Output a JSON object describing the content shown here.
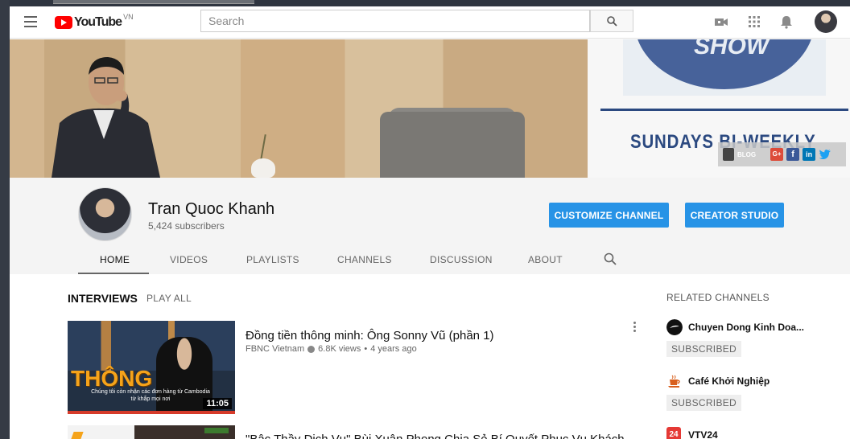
{
  "header": {
    "logo_text": "YouTube",
    "logo_country": "VN",
    "search_placeholder": "Search"
  },
  "banner": {
    "show_text": "SHOW",
    "tagline": "SUNDAYS BI-WEEKLY",
    "social_blog": "BLOG",
    "social_gplus": "G+",
    "social_fb": "f",
    "social_in": "in"
  },
  "channel": {
    "name": "Tran Quoc Khanh",
    "subscribers": "5,424 subscribers",
    "customize_label": "CUSTOMIZE CHANNEL",
    "studio_label": "CREATOR STUDIO"
  },
  "tabs": [
    {
      "label": "HOME"
    },
    {
      "label": "VIDEOS"
    },
    {
      "label": "PLAYLISTS"
    },
    {
      "label": "CHANNELS"
    },
    {
      "label": "DISCUSSION"
    },
    {
      "label": "ABOUT"
    }
  ],
  "shelf": {
    "title": "INTERVIEWS",
    "play_all": "PLAY ALL",
    "videos": [
      {
        "title": "Đồng tiền thông minh: Ông Sonny Vũ (phần 1)",
        "channel": "FBNC Vietnam",
        "views": "6.8K views",
        "age": "4 years ago",
        "duration": "11:05",
        "thumb_big_text": "THÔNG",
        "thumb_caption": "Chúng tôi còn nhận các đơn hàng từ Cambodia từ khắp mọi nơi"
      },
      {
        "title": "\"Bậc Thầy Dịch Vụ\" Bùi Xuân Phong Chia Sẻ Bí Quyết Phục Vụ Khách"
      }
    ]
  },
  "related": {
    "title": "RELATED CHANNELS",
    "channels": [
      {
        "name": "Chuyen Dong Kinh Doa...",
        "subscribe": "SUBSCRIBED"
      },
      {
        "name": "Café Khởi Nghiệp",
        "subscribe": "SUBSCRIBED"
      },
      {
        "name": "VTV24",
        "badge": "24"
      }
    ]
  },
  "colors": {
    "accent_blue": "#2793e6",
    "youtube_red": "#ff0000",
    "banner_navy": "#2b4980"
  },
  "icons": [
    "menu-icon",
    "search-icon",
    "video-camera-icon",
    "apps-grid-icon",
    "bell-icon"
  ]
}
